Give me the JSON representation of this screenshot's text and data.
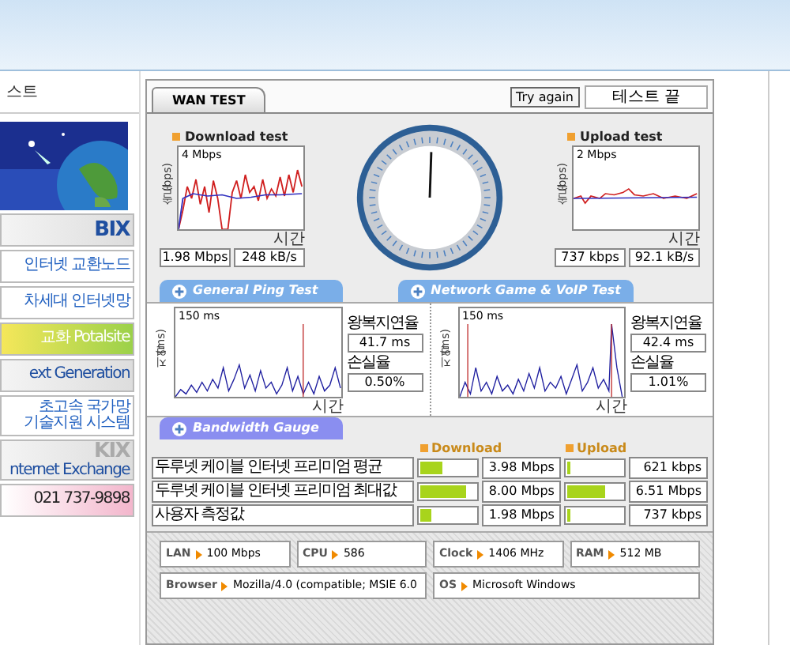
{
  "sidebar": {
    "heading": "스트",
    "banners": [
      {
        "kind": "picture"
      },
      {
        "kind": "logo",
        "lines": [
          "BIX"
        ]
      },
      {
        "kind": "link",
        "lines": [
          "인터넷 교환노드"
        ]
      },
      {
        "kind": "link",
        "lines": [
          "차세대 인터넷망"
        ]
      },
      {
        "kind": "green",
        "lines": [
          "교화 Potalsite"
        ]
      },
      {
        "kind": "logo",
        "lines": [
          "ext Generation"
        ]
      },
      {
        "kind": "link",
        "lines": [
          "초고속 국가망",
          "기술지원 시스템"
        ]
      },
      {
        "kind": "logo",
        "lines": [
          "KIX",
          "nternet Exchange"
        ]
      },
      {
        "kind": "pink",
        "lines": [
          "021 737-9898"
        ]
      }
    ]
  },
  "panel": {
    "tab": {
      "label": "WAN TEST",
      "selected": true
    },
    "try_again": "Try again",
    "status": "테스트 끝",
    "download": {
      "title": "Download test",
      "axis": "속도(bps)",
      "scale": "4 Mbps",
      "time": "시간",
      "rate": "1.98 Mbps",
      "bytes": "248 kB/s"
    },
    "upload": {
      "title": "Upload test",
      "axis": "속도(bps)",
      "scale": "2 Mbps",
      "time": "시간",
      "rate": "737 kbps",
      "bytes": "92.1 kB/s"
    },
    "sections": [
      "General Ping Test",
      "Network Game & VoIP Test"
    ],
    "pings": [
      {
        "axis": "지연(ms)",
        "scale": "150 ms",
        "time": "시간",
        "delay_label": "왕복지연율",
        "delay": "41.7 ms",
        "loss_label": "손실율",
        "loss": "0.50%"
      },
      {
        "axis": "지연(ms)",
        "scale": "150 ms",
        "time": "시간",
        "delay_label": "왕복지연율",
        "delay": "42.4 ms",
        "loss_label": "손실율",
        "loss": "1.01%"
      }
    ],
    "bandwidth": {
      "title": "Bandwidth Gauge",
      "download_label": "Download",
      "upload_label": "Upload",
      "rows": [
        {
          "label": "두루넷 케이블 인터넷 프리미엄 평균",
          "download": {
            "level": 0.41,
            "value": "3.98 Mbps"
          },
          "upload": {
            "level": 0.05,
            "value": "621 kbps"
          }
        },
        {
          "label": "두루넷 케이블 인터넷 프리미엄 최대값",
          "download": {
            "level": 0.83,
            "value": "8.00 Mbps"
          },
          "upload": {
            "level": 0.67,
            "value": "6.51 Mbps"
          }
        },
        {
          "label": "사용자 측정값",
          "download": {
            "level": 0.2,
            "value": "1.98 Mbps"
          },
          "upload": {
            "level": 0.05,
            "value": "737 kbps"
          }
        }
      ]
    },
    "system": [
      [
        {
          "label": "LAN",
          "value": "100 Mbps"
        },
        {
          "label": "CPU",
          "value": "586"
        },
        {
          "label": "Clock",
          "value": "1406 MHz"
        },
        {
          "label": "RAM",
          "value": "512 MB"
        }
      ],
      [
        {
          "label": "Browser",
          "value": "Mozilla/4.0 (compatible; MSIE 6.0"
        },
        {
          "label": "OS",
          "value": "Microsoft Windows"
        }
      ]
    ]
  }
}
